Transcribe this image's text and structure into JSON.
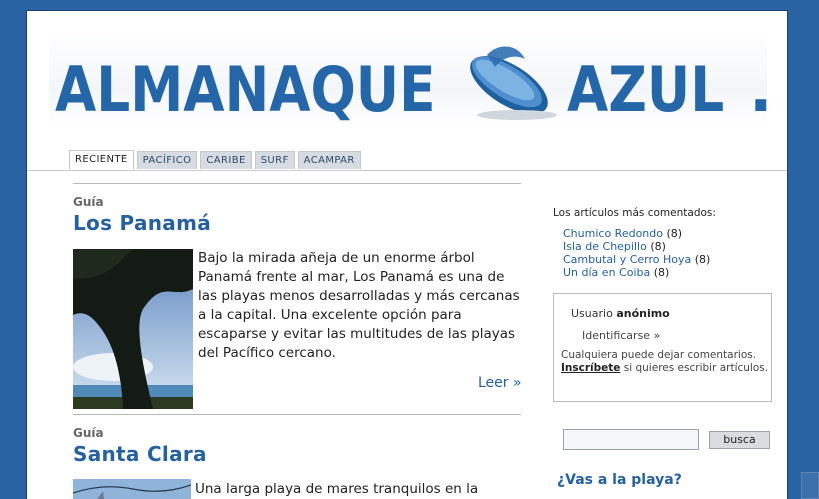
{
  "banner": {
    "logo_left": "ALMANAQUE",
    "logo_right": "AZUL",
    "logo_dot": "."
  },
  "tabs": [
    {
      "label": "RECIENTE",
      "active": true
    },
    {
      "label": "PACÍFICO",
      "active": false
    },
    {
      "label": "CARIBE",
      "active": false
    },
    {
      "label": "SURF",
      "active": false
    },
    {
      "label": "ACAMPAR",
      "active": false
    }
  ],
  "articles": [
    {
      "kicker": "Guía",
      "title": "Los Panamá",
      "body": "Bajo la mirada añeja de un enorme árbol Panamá frente al mar, Los Panamá es una de las playas menos desarrolladas y más cercanas a la capital. Una excelente opción para escaparse y evitar las multitudes de las playas del Pacífico cercano.",
      "read_more": "Leer »"
    },
    {
      "kicker": "Guía",
      "title": "Santa Clara",
      "body": "Una larga playa de mares tranquilos en la"
    }
  ],
  "sidebar": {
    "most_commented_heading": "Los artículos más comentados:",
    "most_commented": [
      {
        "title": "Chumico Redondo",
        "count": "(8)"
      },
      {
        "title": "Isla de Chepillo",
        "count": "(8)"
      },
      {
        "title": "Cambutal y Cerro Hoya",
        "count": "(8)"
      },
      {
        "title": "Un día en Coiba",
        "count": "(8)"
      }
    ],
    "login": {
      "user_label": "Usuario",
      "user_name": "anónimo",
      "login_link": "Identificarse »",
      "note_before": "Cualquiera puede dejar comentarios.",
      "register_link": "Inscríbete",
      "note_after": "si quieres escribir artículos."
    },
    "search": {
      "value": "",
      "button_label": "busca"
    },
    "promo_heading": "¿Vas a la playa?"
  },
  "colors": {
    "background": "#2a63a4",
    "accent": "#24619e"
  }
}
